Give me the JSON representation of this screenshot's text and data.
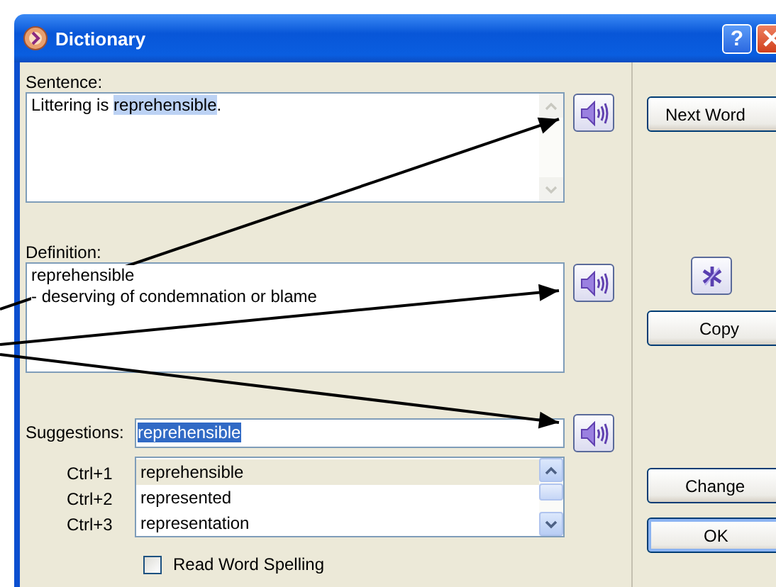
{
  "window": {
    "title": "Dictionary",
    "help": "?"
  },
  "sentence": {
    "label": "Sentence:",
    "before": "Littering is ",
    "highlight": "reprehensible",
    "after": "."
  },
  "definition": {
    "label": "Definition:",
    "lines": [
      "reprehensible",
      "- deserving of condemnation or blame"
    ]
  },
  "suggestions": {
    "label": "Suggestions:",
    "value": "reprehensible",
    "value_selected": true,
    "items": [
      {
        "shortcut": "Ctrl+1",
        "word": "reprehensible",
        "selected": true
      },
      {
        "shortcut": "Ctrl+2",
        "word": "represented",
        "selected": false
      },
      {
        "shortcut": "Ctrl+3",
        "word": "representation",
        "selected": false
      }
    ]
  },
  "read_word_spelling": {
    "label": "Read Word Spelling",
    "checked": false
  },
  "buttons": {
    "next_word": "Next Word",
    "copy": "Copy",
    "change": "Change",
    "ok": "OK"
  }
}
